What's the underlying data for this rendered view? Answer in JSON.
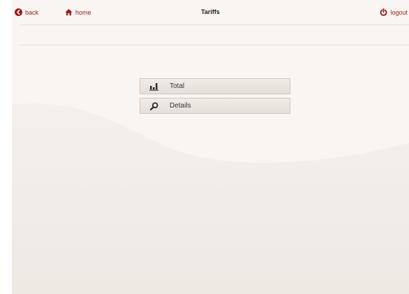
{
  "header": {
    "back_label": "back",
    "home_label": "home",
    "title": "Tariffs",
    "logout_label": "logout"
  },
  "menu": {
    "items": [
      {
        "label": "Total",
        "icon": "bar-chart-icon"
      },
      {
        "label": "Details",
        "icon": "magnifier-icon"
      }
    ]
  },
  "colors": {
    "accent": "#9b1c1c",
    "background": "#f3efeb",
    "button_border": "#cfc6be"
  }
}
